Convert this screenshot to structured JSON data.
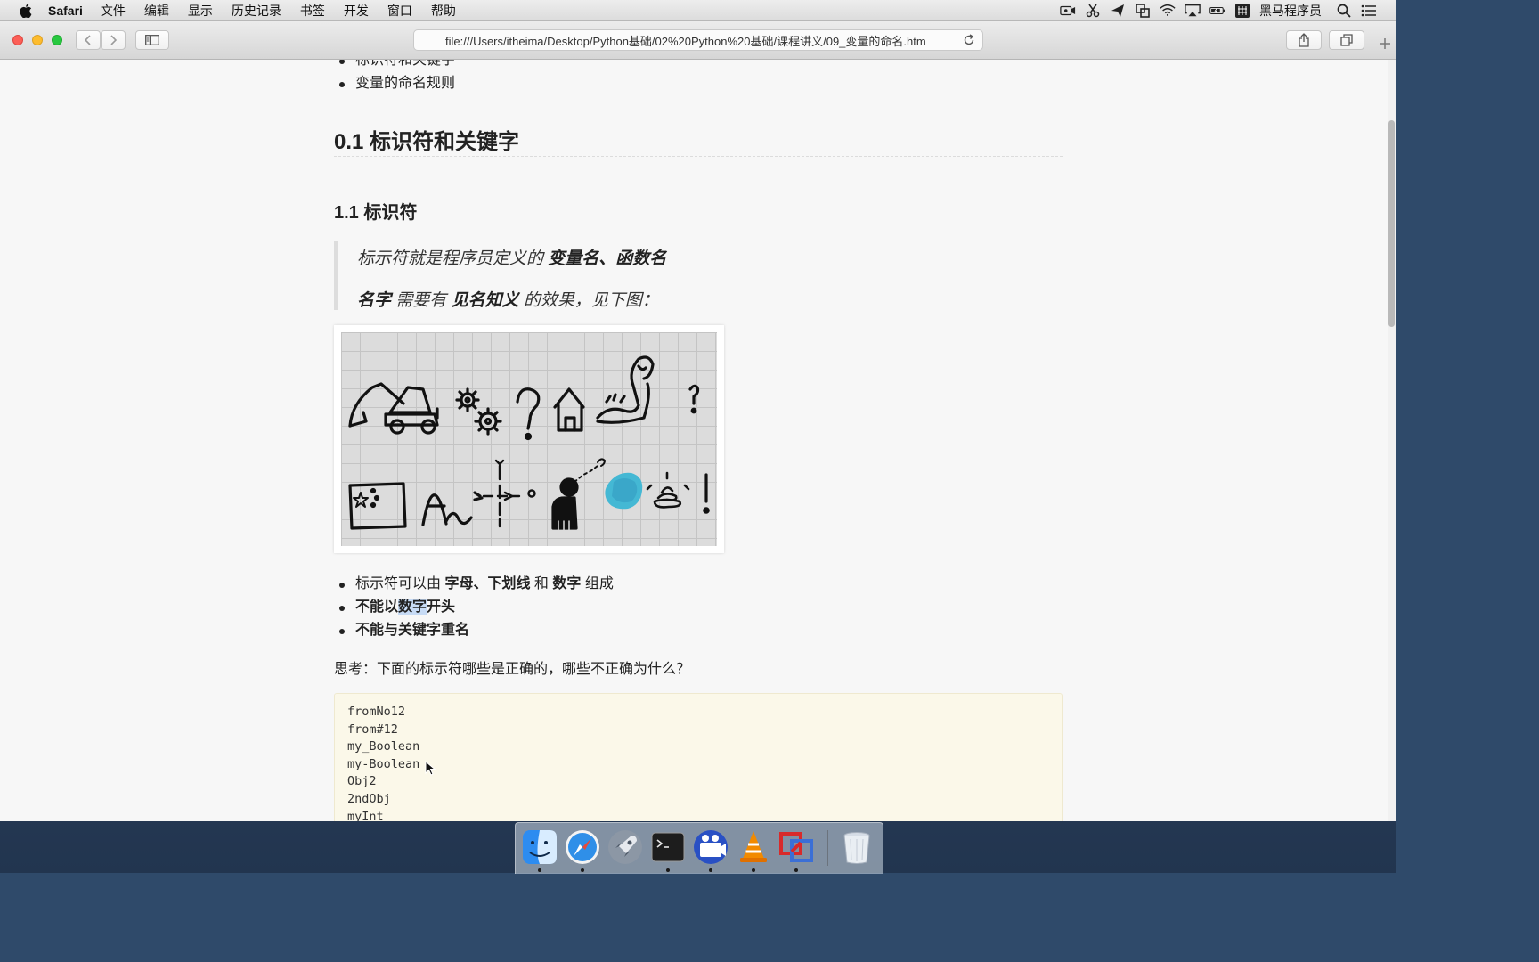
{
  "menubar": {
    "app_name": "Safari",
    "menus": [
      "文件",
      "编辑",
      "显示",
      "历史记录",
      "书签",
      "开发",
      "窗口",
      "帮助"
    ],
    "user": "黑马程序员"
  },
  "browser": {
    "url": "file:///Users/itheima/Desktop/Python基础/02%20Python%20基础/课程讲义/09_变量的命名.htm"
  },
  "page": {
    "top_list": [
      "标识符和关键字",
      "变量的命名规则"
    ],
    "h2": "0.1 标识符和关键字",
    "h3": "1.1 标识符",
    "quote": {
      "line1_prefix": "标示符就是程序员定义的 ",
      "line1_bold": "变量名、函数名",
      "line2_bold1": "名字",
      "line2_mid": " 需要有 ",
      "line2_bold2": "见名知义",
      "line2_suffix": " 的效果，见下图："
    },
    "rules": {
      "r1_prefix": "标示符可以由 ",
      "r1_bold1": "字母、下划线",
      "r1_mid": " 和 ",
      "r1_bold2": "数字",
      "r1_suffix": " 组成",
      "r2_a": "不能以",
      "r2_hl": "数字",
      "r2_b": "开头",
      "r3": "不能与关键字重名"
    },
    "question": "思考：下面的标示符哪些是正确的，哪些不正确为什么？",
    "code_lines": [
      "fromNo12",
      "from#12",
      "my_Boolean",
      "my-Boolean",
      "Obj2",
      "2ndObj",
      "myInt"
    ]
  },
  "dock_apps": [
    "finder-icon",
    "safari-icon",
    "launchpad-icon",
    "terminal-icon",
    "screenflow-icon",
    "vlc-icon",
    "parallels-icon",
    "trash-icon"
  ]
}
